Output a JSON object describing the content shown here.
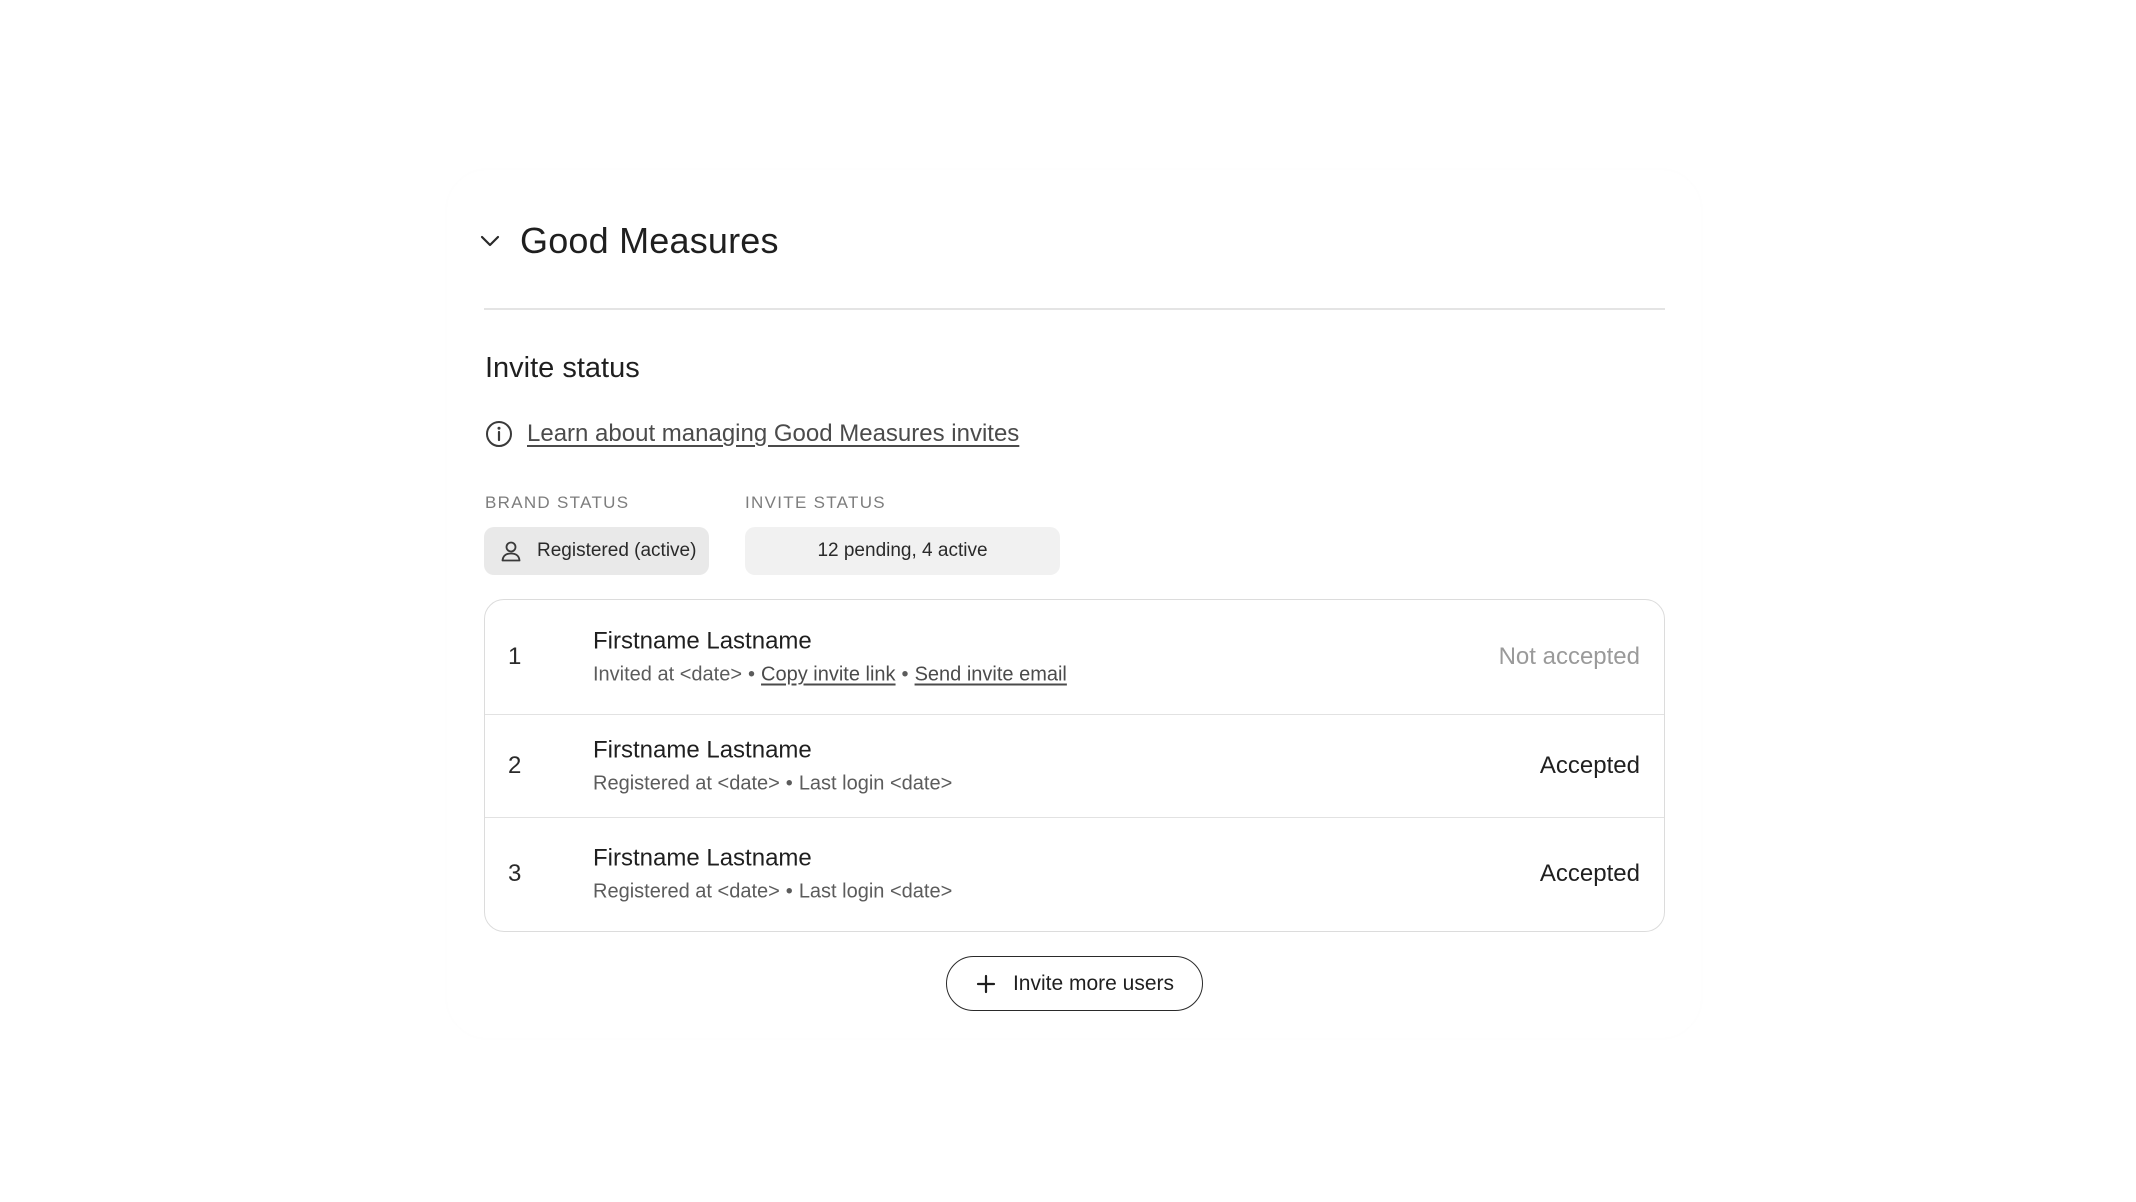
{
  "group": {
    "title": "Good Measures",
    "expanded_icon": "chevron-down-icon"
  },
  "section": {
    "title": "Invite status",
    "learn_link": "Learn about managing Good Measures invites",
    "info_icon": "info-icon"
  },
  "status": {
    "brand_label": "BRAND STATUS",
    "brand_value": "Registered (active)",
    "brand_icon": "person-icon",
    "invite_label": "INVITE STATUS",
    "invite_value": "12 pending, 4 active"
  },
  "rows": [
    {
      "number": "1",
      "name": "Firstname Lastname",
      "meta_text": "Invited at <date>",
      "copy_link": "Copy invite link",
      "send_link": "Send invite email",
      "status": "Not accepted"
    },
    {
      "number": "2",
      "name": "Firstname Lastname",
      "meta_registered": "Registered at <date>",
      "meta_login": "Last login <date>",
      "status": "Accepted"
    },
    {
      "number": "3",
      "name": "Firstname Lastname",
      "meta_registered": "Registered at <date>",
      "meta_login": "Last login <date>",
      "status": "Accepted"
    }
  ],
  "separator": "•",
  "invite_button": {
    "label": "Invite more users",
    "icon": "plus-icon"
  },
  "colors": {
    "text": "#1f1f1f",
    "muted": "#9a9a9a",
    "brand_pill": "#e9e9e9",
    "invite_pill": "#f1f1f1"
  }
}
